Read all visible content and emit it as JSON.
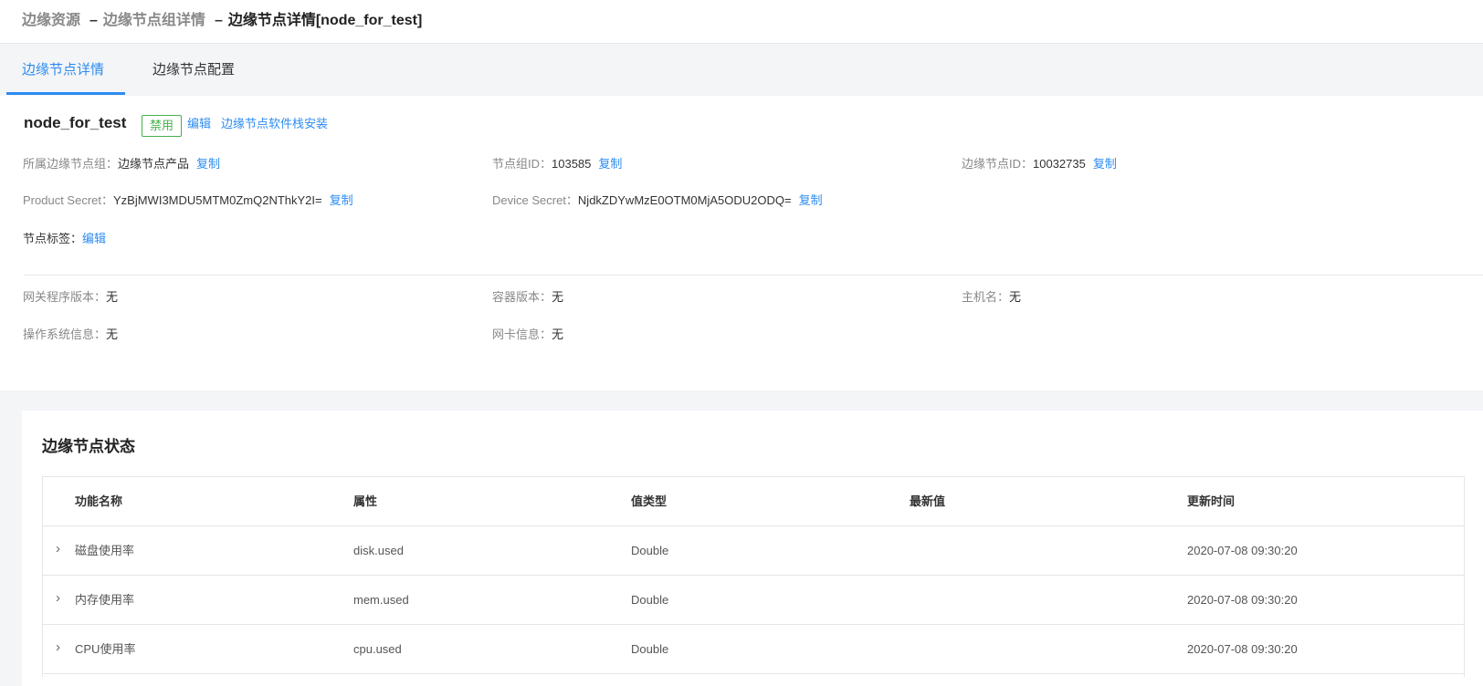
{
  "breadcrumb": {
    "items": [
      "边缘资源",
      "边缘节点组详情"
    ],
    "separator": "–",
    "current": "边缘节点详情[node_for_test]"
  },
  "tabs": [
    {
      "label": "边缘节点详情",
      "active": true
    },
    {
      "label": "边缘节点配置",
      "active": false
    }
  ],
  "node": {
    "name": "node_for_test",
    "status_badge": "禁用",
    "edit_link": "编辑",
    "install_link": "边缘节点软件栈安装"
  },
  "info": {
    "group": {
      "label": "所属边缘节点组：",
      "value": "边缘节点产品",
      "action": "复制"
    },
    "group_id": {
      "label": "节点组ID：",
      "value": "103585",
      "action": "复制"
    },
    "node_id": {
      "label": "边缘节点ID：",
      "value": "10032735",
      "action": "复制"
    },
    "product_secret": {
      "label": "Product Secret：",
      "value": "YzBjMWI3MDU5MTM0ZmQ2NThkY2I=",
      "action": "复制"
    },
    "device_secret": {
      "label": "Device Secret：",
      "value": "NjdkZDYwMzE0OTM0MjA5ODU2ODQ=",
      "action": "复制"
    },
    "tags": {
      "label": "节点标签：",
      "action": "编辑"
    },
    "gateway_version": {
      "label": "网关程序版本：",
      "value": "无"
    },
    "container_version": {
      "label": "容器版本：",
      "value": "无"
    },
    "hostname": {
      "label": "主机名：",
      "value": "无"
    },
    "os_info": {
      "label": "操作系统信息：",
      "value": "无"
    },
    "nic_info": {
      "label": "网卡信息：",
      "value": "无"
    }
  },
  "status": {
    "title": "边缘节点状态",
    "columns": [
      "功能名称",
      "属性",
      "值类型",
      "最新值",
      "更新时间"
    ],
    "rows": [
      {
        "name": "磁盘使用率",
        "attr": "disk.used",
        "type": "Double",
        "latest": "",
        "time": "2020-07-08 09:30:20"
      },
      {
        "name": "内存使用率",
        "attr": "mem.used",
        "type": "Double",
        "latest": "",
        "time": "2020-07-08 09:30:20"
      },
      {
        "name": "CPU使用率",
        "attr": "cpu.used",
        "type": "Double",
        "latest": "",
        "time": "2020-07-08 09:30:20"
      }
    ]
  },
  "icons": {
    "expand": "chevron-right-icon"
  }
}
